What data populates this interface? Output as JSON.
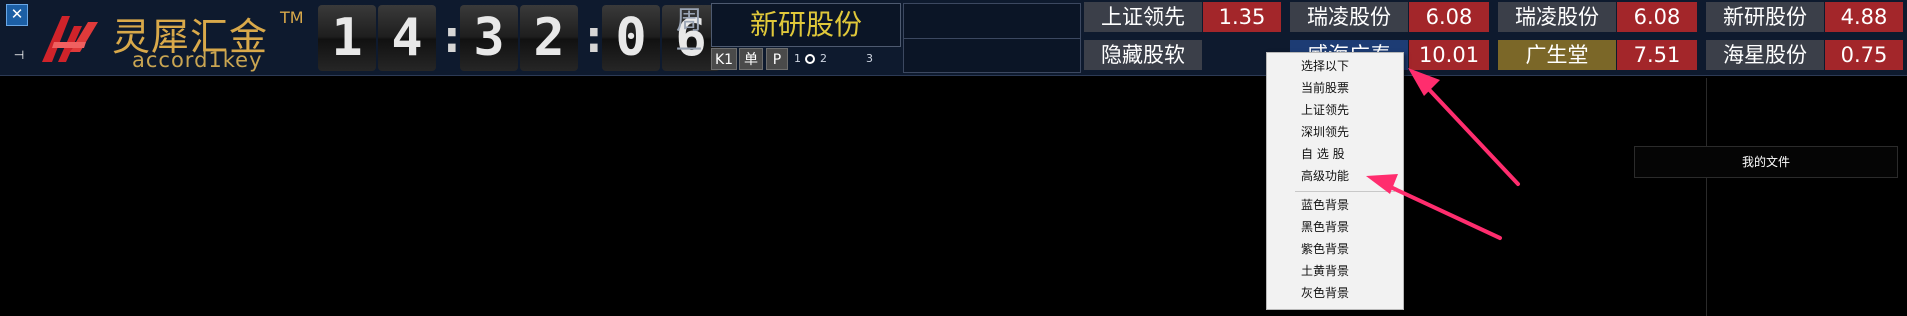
{
  "logo": {
    "cn": "灵犀汇金",
    "tm": "TM",
    "en": "accord1key"
  },
  "window": {
    "close_glyph": "✕",
    "pin_glyph": "⊣"
  },
  "clock": {
    "h1": "1",
    "h2": "4",
    "m1": "3",
    "m2": "2",
    "s1": "0",
    "s2": "6",
    "sep": ":"
  },
  "weekday": {
    "l1": "周",
    "l2": "一"
  },
  "stock": {
    "name": "新研股份"
  },
  "period_buttons": [
    "K1",
    "单",
    "P"
  ],
  "radio": {
    "o1": "1",
    "o2": "2",
    "o3": "3"
  },
  "ticker": {
    "row1": [
      {
        "name": "上证领先",
        "value": "1.35"
      },
      {
        "name": "瑞凌股份",
        "value": "6.08"
      },
      {
        "name": "瑞凌股份",
        "value": "6.08"
      },
      {
        "name": "新研股份",
        "value": "4.88"
      }
    ],
    "row2": [
      {
        "name": "隐藏股软",
        "value": ""
      },
      {
        "name": "威海广泰",
        "value": "10.01"
      },
      {
        "name": "广生堂",
        "value": "7.51"
      },
      {
        "name": "海星股份",
        "value": "0.75"
      }
    ]
  },
  "context_menu": {
    "group1": [
      "选择以下",
      "当前股票",
      "上证领先",
      "深圳领先",
      "自 选 股",
      "高级功能"
    ],
    "group2": [
      "蓝色背景",
      "黑色背景",
      "紫色背景",
      "土黄背景",
      "灰色背景"
    ]
  },
  "desktop": {
    "folder_label": "我的文件"
  },
  "colors": {
    "value_red": "#a3262a",
    "name_gray": "#3b3f49",
    "highlight_blue": "#1d3c74",
    "gold": "#7b6728",
    "arrow": "#ff2d6e"
  }
}
